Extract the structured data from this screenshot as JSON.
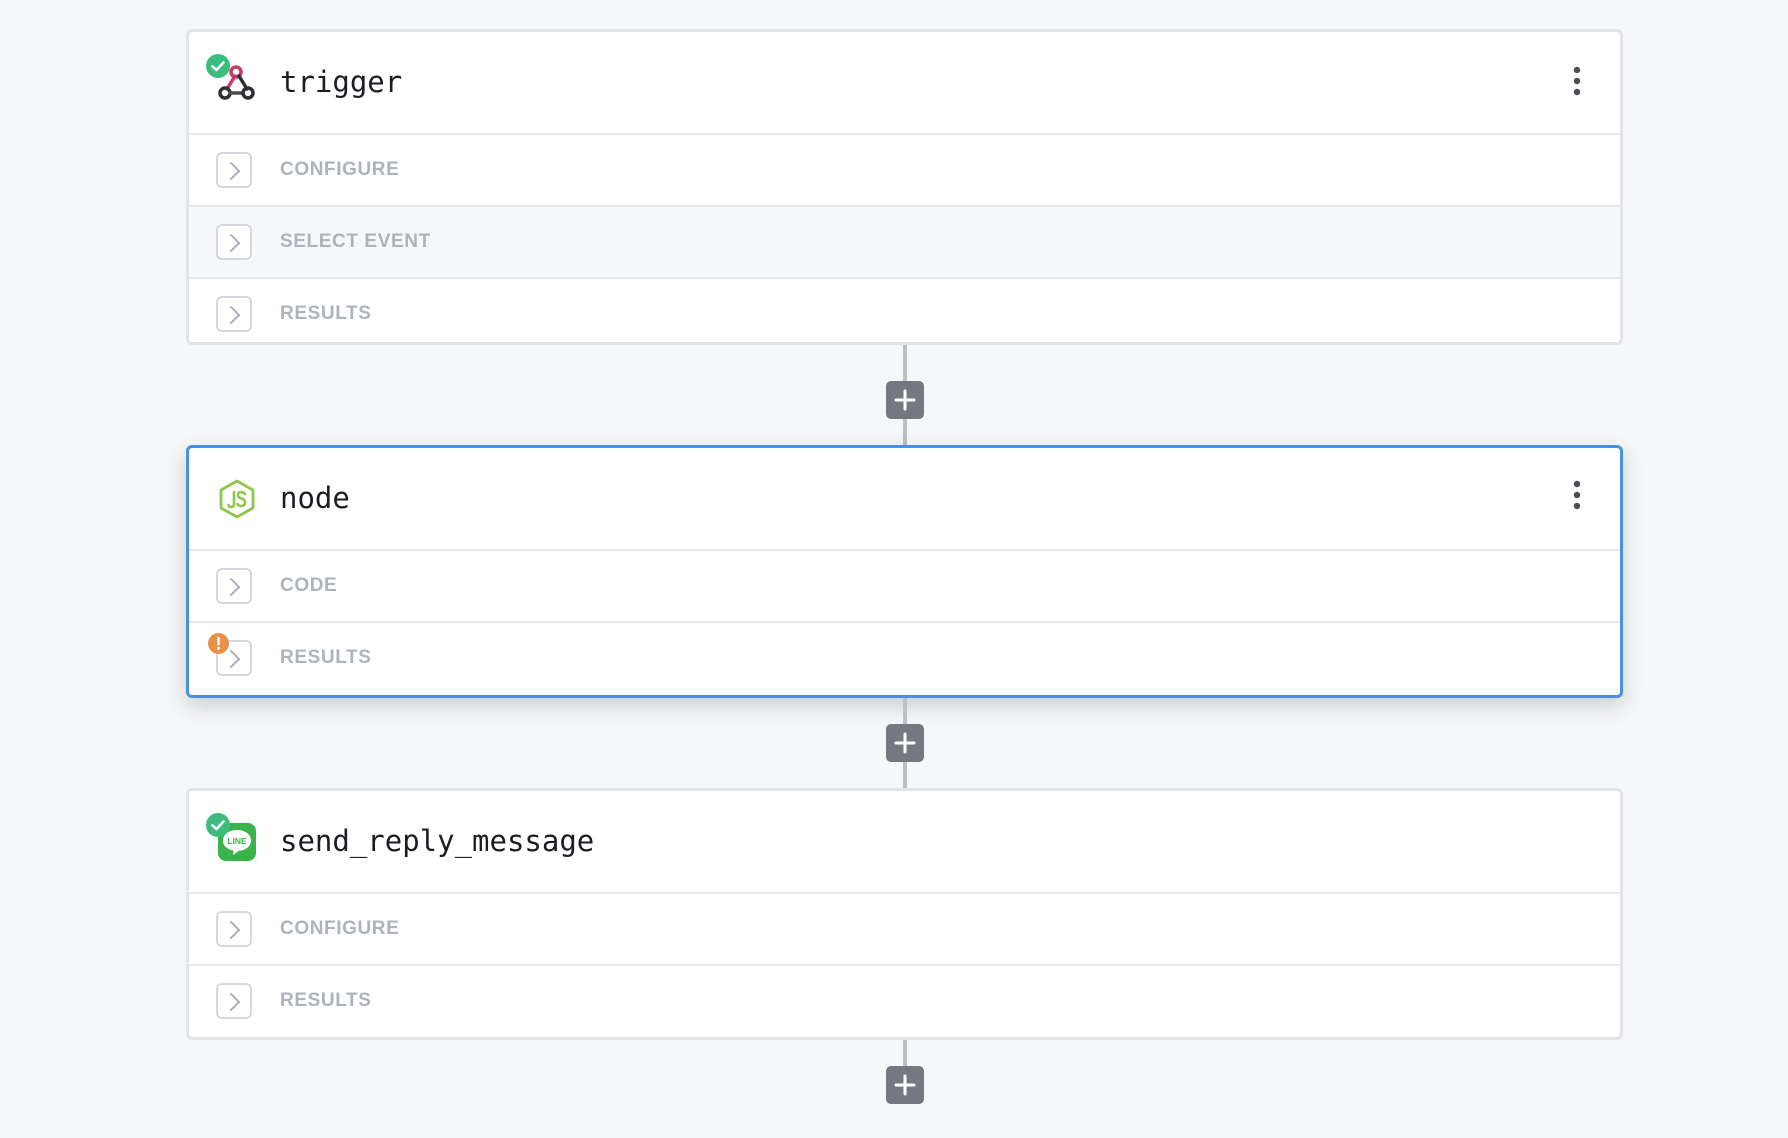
{
  "steps": [
    {
      "title": "trigger",
      "icon": "webhook-icon",
      "status": "success",
      "has_menu": true,
      "sections": [
        {
          "label": "CONFIGURE"
        },
        {
          "label": "SELECT EVENT"
        },
        {
          "label": "RESULTS"
        }
      ]
    },
    {
      "title": "node",
      "icon": "nodejs-icon",
      "status": "selected",
      "has_menu": true,
      "sections": [
        {
          "label": "CODE"
        },
        {
          "label": "RESULTS",
          "badge": "warning"
        }
      ]
    },
    {
      "title": "send_reply_message",
      "icon": "line-app-icon",
      "status": "success",
      "has_menu": false,
      "sections": [
        {
          "label": "CONFIGURE"
        },
        {
          "label": "RESULTS"
        }
      ]
    }
  ],
  "colors": {
    "background": "#f6f7f9",
    "card_border": "#e2e4e8",
    "selected_border": "#4a90e2",
    "success": "#3dbd7d",
    "warning": "#e8914b",
    "section_label": "#aeb3bb",
    "add_button": "#75787e",
    "connector": "#bcc0c6",
    "nodejs_green": "#8cc84b",
    "line_green": "#3ab44a",
    "webhook_red": "#c73a63"
  }
}
